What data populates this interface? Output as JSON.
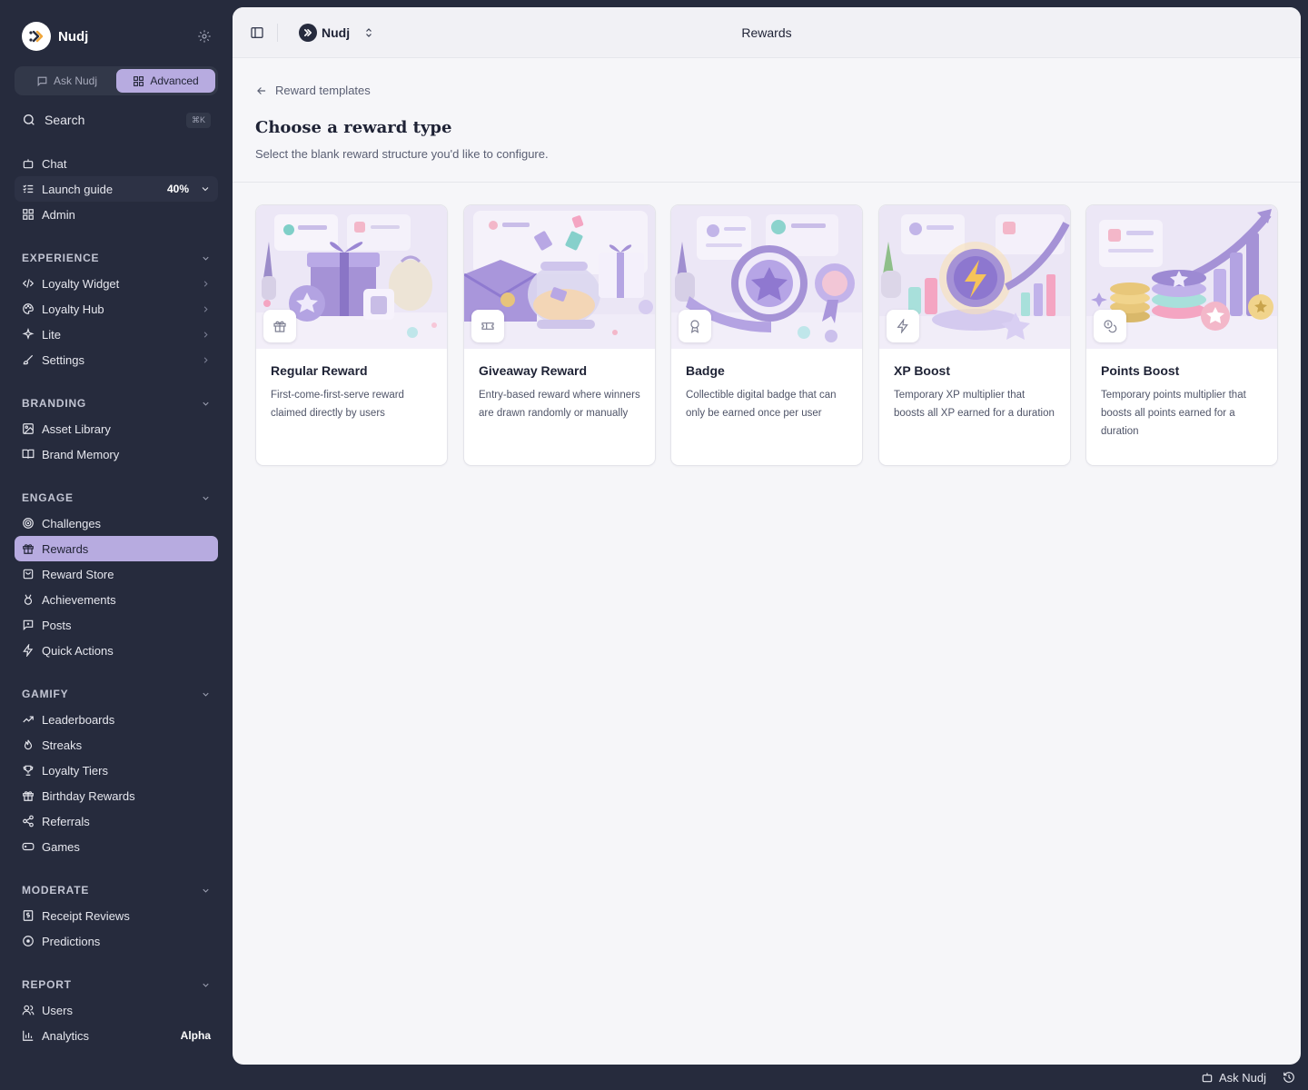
{
  "brand": {
    "name": "Nudj"
  },
  "mode_toggle": {
    "ask_label": "Ask Nudj",
    "advanced_label": "Advanced",
    "active": "advanced"
  },
  "search": {
    "label": "Search",
    "shortcut": "⌘K"
  },
  "top_nav": [
    {
      "label": "Chat",
      "icon": "bot-icon"
    },
    {
      "label": "Launch guide",
      "icon": "checklist-icon",
      "progress": "40%"
    },
    {
      "label": "Admin",
      "icon": "grid-icon"
    }
  ],
  "sections": {
    "experience": {
      "title": "EXPERIENCE",
      "items": [
        {
          "label": "Loyalty Widget",
          "icon": "code-icon"
        },
        {
          "label": "Loyalty Hub",
          "icon": "palette-icon"
        },
        {
          "label": "Lite",
          "icon": "sparkle-icon"
        },
        {
          "label": "Settings",
          "icon": "brush-icon"
        }
      ]
    },
    "branding": {
      "title": "BRANDING",
      "items": [
        {
          "label": "Asset Library",
          "icon": "image-icon"
        },
        {
          "label": "Brand Memory",
          "icon": "book-icon"
        }
      ]
    },
    "engage": {
      "title": "ENGAGE",
      "items": [
        {
          "label": "Challenges",
          "icon": "target-icon"
        },
        {
          "label": "Rewards",
          "icon": "gift-icon",
          "active": true
        },
        {
          "label": "Reward Store",
          "icon": "store-icon"
        },
        {
          "label": "Achievements",
          "icon": "medal-icon"
        },
        {
          "label": "Posts",
          "icon": "post-icon"
        },
        {
          "label": "Quick Actions",
          "icon": "zap-icon"
        }
      ]
    },
    "gamify": {
      "title": "GAMIFY",
      "items": [
        {
          "label": "Leaderboards",
          "icon": "trend-icon"
        },
        {
          "label": "Streaks",
          "icon": "flame-icon"
        },
        {
          "label": "Loyalty Tiers",
          "icon": "trophy-icon"
        },
        {
          "label": "Birthday Rewards",
          "icon": "gift-icon"
        },
        {
          "label": "Referrals",
          "icon": "share-icon"
        },
        {
          "label": "Games",
          "icon": "gamepad-icon"
        }
      ]
    },
    "moderate": {
      "title": "MODERATE",
      "items": [
        {
          "label": "Receipt Reviews",
          "icon": "receipt-icon"
        },
        {
          "label": "Predictions",
          "icon": "circle-icon"
        }
      ]
    },
    "report": {
      "title": "REPORT",
      "items": [
        {
          "label": "Users",
          "icon": "users-icon"
        },
        {
          "label": "Analytics",
          "icon": "chart-icon",
          "badge": "Alpha"
        }
      ]
    }
  },
  "topbar": {
    "workspace": "Nudj",
    "title": "Rewards"
  },
  "page": {
    "back_label": "Reward templates",
    "title": "Choose a reward type",
    "subtitle": "Select the blank reward structure you'd like to configure."
  },
  "cards": [
    {
      "title": "Regular Reward",
      "desc": "First-come-first-serve reward claimed directly by users",
      "icon": "gift-icon"
    },
    {
      "title": "Giveaway Reward",
      "desc": "Entry-based reward where winners are drawn randomly or manually",
      "icon": "ticket-icon"
    },
    {
      "title": "Badge",
      "desc": "Collectible digital badge that can only be earned once per user",
      "icon": "award-icon"
    },
    {
      "title": "XP Boost",
      "desc": "Temporary XP multiplier that boosts all XP earned for a duration",
      "icon": "zap-icon"
    },
    {
      "title": "Points Boost",
      "desc": "Temporary points multiplier that boosts all points earned for a duration",
      "icon": "coins-icon"
    }
  ],
  "footer": {
    "ask_label": "Ask Nudj"
  },
  "colors": {
    "sidebar_bg": "#262b3d",
    "accent": "#b7abe0",
    "main_bg": "#f6f6f9"
  }
}
